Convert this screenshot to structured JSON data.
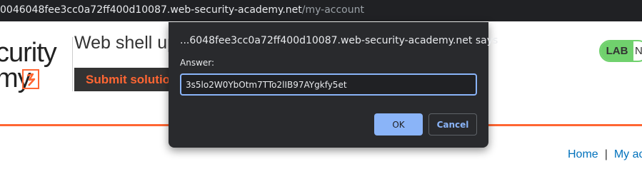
{
  "browser": {
    "url_host": "0046048fee3cc0a72ff400d10087.web-security-academy.net",
    "url_path": "/my-account"
  },
  "page": {
    "logo_line1": "curity",
    "logo_line2": "my",
    "lab_title": "Web shell up",
    "submit_label": "Submit solution",
    "lab_badge": "LAB",
    "lab_status": "N",
    "nav": {
      "home": "Home",
      "separator": "|",
      "my_account": "My ac"
    }
  },
  "dialog": {
    "title": "...6048fee3cc0a72ff400d10087.web-security-academy.net says",
    "label": "Answer:",
    "answer_value": "3s5lo2W0YbOtm7TTo2lIB97AYgkfy5et",
    "ok_label": "OK",
    "cancel_label": "Cancel"
  },
  "colors": {
    "accent": "#ff6633",
    "lab_green": "#70d16d",
    "dialog_blue": "#8ab4f8",
    "link_blue": "#0071bc"
  }
}
